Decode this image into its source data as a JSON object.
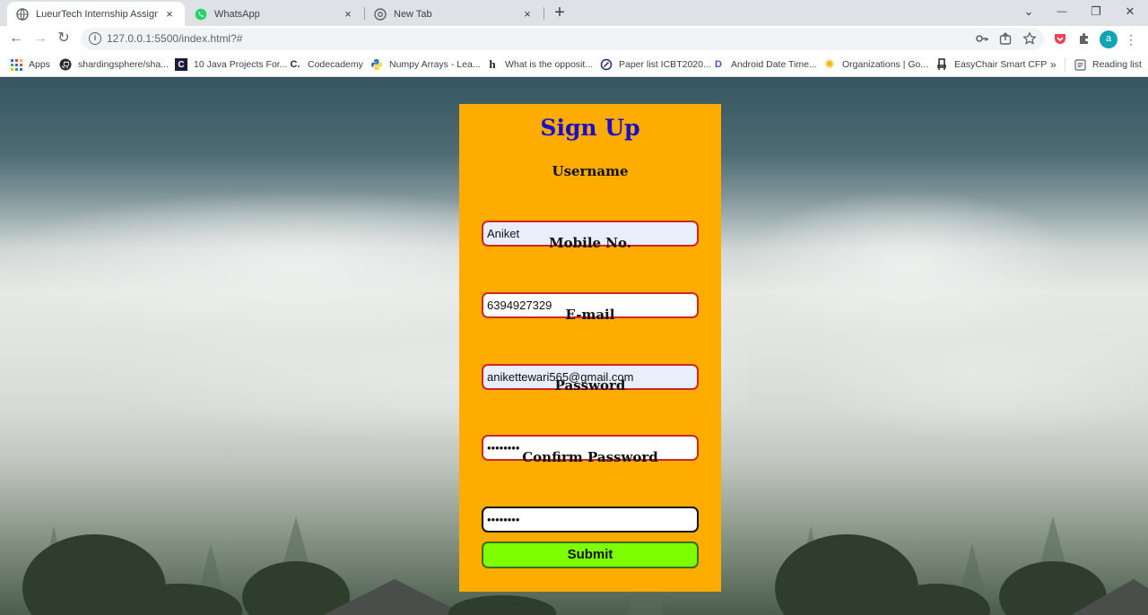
{
  "browser": {
    "tabs": [
      {
        "label": "LueurTech Internship Assignment",
        "close": "×"
      },
      {
        "label": "WhatsApp",
        "close": "×"
      },
      {
        "label": "New Tab",
        "close": "×"
      }
    ],
    "new_tab": "+",
    "window_controls": {
      "dropdown": "⌄",
      "minimize": "—",
      "maximize": "❐",
      "close": "✕"
    },
    "nav": {
      "back": "←",
      "forward": "→",
      "reload": "↻"
    },
    "url": "127.0.0.1:5500/index.html?#",
    "avatar_letter": "a",
    "bookmarks": [
      {
        "label": "Apps",
        "icon": "apps-grid-icon"
      },
      {
        "label": "shardingsphere/sha...",
        "icon": "github-icon"
      },
      {
        "label": "10 Java Projects For...",
        "icon": "codex-icon"
      },
      {
        "label": "Codecademy",
        "icon": "codecademy-icon"
      },
      {
        "label": "Numpy Arrays - Lea...",
        "icon": "python-icon"
      },
      {
        "label": "What is the opposit...",
        "icon": "h-icon"
      },
      {
        "label": "Paper list ICBT2020...",
        "icon": "edit-icon"
      },
      {
        "label": "Android Date Time...",
        "icon": "dd-icon"
      },
      {
        "label": "Organizations | Go...",
        "icon": "sun-icon"
      },
      {
        "label": "EasyChair Smart CFP",
        "icon": "chair-icon"
      }
    ],
    "bookmarks_overflow": "»",
    "reading_list": "Reading list"
  },
  "form": {
    "title": "Sign Up",
    "fields": [
      {
        "label": "Username",
        "value": "Aniket"
      },
      {
        "label": "Mobile No.",
        "value": "6394927329"
      },
      {
        "label": "E-mail",
        "value": "anikettewari565@gmail.com"
      },
      {
        "label": "Password",
        "value": "••••••••"
      },
      {
        "label": "Confirm Password",
        "value": "••••••••"
      }
    ],
    "submit_label": "Submit"
  },
  "colors": {
    "card_bg": "#ffac00",
    "title": "#1a0dcc",
    "input_border": "#d0262a",
    "submit_bg": "#7dff00"
  }
}
